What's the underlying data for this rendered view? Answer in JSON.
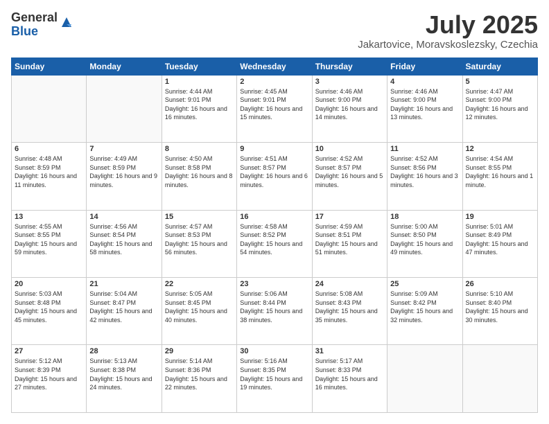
{
  "logo": {
    "general": "General",
    "blue": "Blue"
  },
  "title": "July 2025",
  "location": "Jakartovice, Moravskoslezsky, Czechia",
  "weekdays": [
    "Sunday",
    "Monday",
    "Tuesday",
    "Wednesday",
    "Thursday",
    "Friday",
    "Saturday"
  ],
  "weeks": [
    [
      {
        "day": "",
        "info": ""
      },
      {
        "day": "",
        "info": ""
      },
      {
        "day": "1",
        "info": "Sunrise: 4:44 AM\nSunset: 9:01 PM\nDaylight: 16 hours and 16 minutes."
      },
      {
        "day": "2",
        "info": "Sunrise: 4:45 AM\nSunset: 9:01 PM\nDaylight: 16 hours and 15 minutes."
      },
      {
        "day": "3",
        "info": "Sunrise: 4:46 AM\nSunset: 9:00 PM\nDaylight: 16 hours and 14 minutes."
      },
      {
        "day": "4",
        "info": "Sunrise: 4:46 AM\nSunset: 9:00 PM\nDaylight: 16 hours and 13 minutes."
      },
      {
        "day": "5",
        "info": "Sunrise: 4:47 AM\nSunset: 9:00 PM\nDaylight: 16 hours and 12 minutes."
      }
    ],
    [
      {
        "day": "6",
        "info": "Sunrise: 4:48 AM\nSunset: 8:59 PM\nDaylight: 16 hours and 11 minutes."
      },
      {
        "day": "7",
        "info": "Sunrise: 4:49 AM\nSunset: 8:59 PM\nDaylight: 16 hours and 9 minutes."
      },
      {
        "day": "8",
        "info": "Sunrise: 4:50 AM\nSunset: 8:58 PM\nDaylight: 16 hours and 8 minutes."
      },
      {
        "day": "9",
        "info": "Sunrise: 4:51 AM\nSunset: 8:57 PM\nDaylight: 16 hours and 6 minutes."
      },
      {
        "day": "10",
        "info": "Sunrise: 4:52 AM\nSunset: 8:57 PM\nDaylight: 16 hours and 5 minutes."
      },
      {
        "day": "11",
        "info": "Sunrise: 4:52 AM\nSunset: 8:56 PM\nDaylight: 16 hours and 3 minutes."
      },
      {
        "day": "12",
        "info": "Sunrise: 4:54 AM\nSunset: 8:55 PM\nDaylight: 16 hours and 1 minute."
      }
    ],
    [
      {
        "day": "13",
        "info": "Sunrise: 4:55 AM\nSunset: 8:55 PM\nDaylight: 15 hours and 59 minutes."
      },
      {
        "day": "14",
        "info": "Sunrise: 4:56 AM\nSunset: 8:54 PM\nDaylight: 15 hours and 58 minutes."
      },
      {
        "day": "15",
        "info": "Sunrise: 4:57 AM\nSunset: 8:53 PM\nDaylight: 15 hours and 56 minutes."
      },
      {
        "day": "16",
        "info": "Sunrise: 4:58 AM\nSunset: 8:52 PM\nDaylight: 15 hours and 54 minutes."
      },
      {
        "day": "17",
        "info": "Sunrise: 4:59 AM\nSunset: 8:51 PM\nDaylight: 15 hours and 51 minutes."
      },
      {
        "day": "18",
        "info": "Sunrise: 5:00 AM\nSunset: 8:50 PM\nDaylight: 15 hours and 49 minutes."
      },
      {
        "day": "19",
        "info": "Sunrise: 5:01 AM\nSunset: 8:49 PM\nDaylight: 15 hours and 47 minutes."
      }
    ],
    [
      {
        "day": "20",
        "info": "Sunrise: 5:03 AM\nSunset: 8:48 PM\nDaylight: 15 hours and 45 minutes."
      },
      {
        "day": "21",
        "info": "Sunrise: 5:04 AM\nSunset: 8:47 PM\nDaylight: 15 hours and 42 minutes."
      },
      {
        "day": "22",
        "info": "Sunrise: 5:05 AM\nSunset: 8:45 PM\nDaylight: 15 hours and 40 minutes."
      },
      {
        "day": "23",
        "info": "Sunrise: 5:06 AM\nSunset: 8:44 PM\nDaylight: 15 hours and 38 minutes."
      },
      {
        "day": "24",
        "info": "Sunrise: 5:08 AM\nSunset: 8:43 PM\nDaylight: 15 hours and 35 minutes."
      },
      {
        "day": "25",
        "info": "Sunrise: 5:09 AM\nSunset: 8:42 PM\nDaylight: 15 hours and 32 minutes."
      },
      {
        "day": "26",
        "info": "Sunrise: 5:10 AM\nSunset: 8:40 PM\nDaylight: 15 hours and 30 minutes."
      }
    ],
    [
      {
        "day": "27",
        "info": "Sunrise: 5:12 AM\nSunset: 8:39 PM\nDaylight: 15 hours and 27 minutes."
      },
      {
        "day": "28",
        "info": "Sunrise: 5:13 AM\nSunset: 8:38 PM\nDaylight: 15 hours and 24 minutes."
      },
      {
        "day": "29",
        "info": "Sunrise: 5:14 AM\nSunset: 8:36 PM\nDaylight: 15 hours and 22 minutes."
      },
      {
        "day": "30",
        "info": "Sunrise: 5:16 AM\nSunset: 8:35 PM\nDaylight: 15 hours and 19 minutes."
      },
      {
        "day": "31",
        "info": "Sunrise: 5:17 AM\nSunset: 8:33 PM\nDaylight: 15 hours and 16 minutes."
      },
      {
        "day": "",
        "info": ""
      },
      {
        "day": "",
        "info": ""
      }
    ]
  ]
}
